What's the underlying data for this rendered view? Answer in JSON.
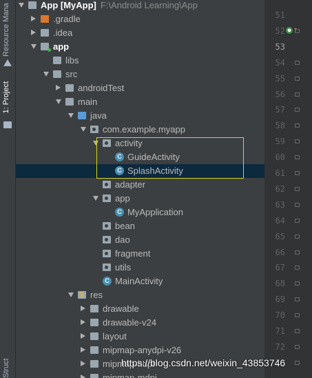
{
  "tool_windows": {
    "resource_manager": "Resource Manager",
    "project": "1: Project",
    "structure": "Structure"
  },
  "tree": [
    {
      "name": "App [MyApp]",
      "path": "F:\\Android Learning\\App",
      "kind": "module",
      "bold": true
    },
    {
      "name": ".gradle",
      "kind": "folder-orange"
    },
    {
      "name": ".idea",
      "kind": "folder"
    },
    {
      "name": "app",
      "kind": "folder-green",
      "bold": true
    },
    {
      "name": "libs",
      "kind": "folder"
    },
    {
      "name": "src",
      "kind": "folder"
    },
    {
      "name": "androidTest",
      "kind": "folder"
    },
    {
      "name": "main",
      "kind": "folder"
    },
    {
      "name": "java",
      "kind": "folder-blue"
    },
    {
      "name": "com.example.myapp",
      "kind": "package"
    },
    {
      "name": "activity",
      "kind": "package"
    },
    {
      "name": "GuideActivity",
      "kind": "class"
    },
    {
      "name": "SplashActivity",
      "kind": "class",
      "selected": true
    },
    {
      "name": "adapter",
      "kind": "package"
    },
    {
      "name": "app",
      "kind": "package"
    },
    {
      "name": "MyApplication",
      "kind": "class"
    },
    {
      "name": "bean",
      "kind": "package"
    },
    {
      "name": "dao",
      "kind": "package"
    },
    {
      "name": "fragment",
      "kind": "package"
    },
    {
      "name": "utils",
      "kind": "package"
    },
    {
      "name": "MainActivity",
      "kind": "class"
    },
    {
      "name": "res",
      "kind": "folder-res"
    },
    {
      "name": "drawable",
      "kind": "folder"
    },
    {
      "name": "drawable-v24",
      "kind": "folder"
    },
    {
      "name": "layout",
      "kind": "folder"
    },
    {
      "name": "mipmap-anydpi-v26",
      "kind": "folder"
    },
    {
      "name": "mipmap-hdpi",
      "kind": "folder"
    },
    {
      "name": "mipmap-mdpi",
      "kind": "folder"
    }
  ],
  "class_glyph": "C",
  "line_numbers": [
    "51",
    "52",
    "53",
    "54",
    "55",
    "56",
    "57",
    "58",
    "59",
    "60",
    "61",
    "62",
    "63",
    "64",
    "65",
    "66",
    "67",
    "68",
    "69",
    "70",
    "71",
    "72",
    "73"
  ],
  "watermark": "https://blog.csdn.net/weixin_43853746",
  "colors": {
    "background": "#3c3f41",
    "selection": "#0d293e",
    "highlight_box": "#d6d61a",
    "class_icon": "#4a8fb0"
  }
}
